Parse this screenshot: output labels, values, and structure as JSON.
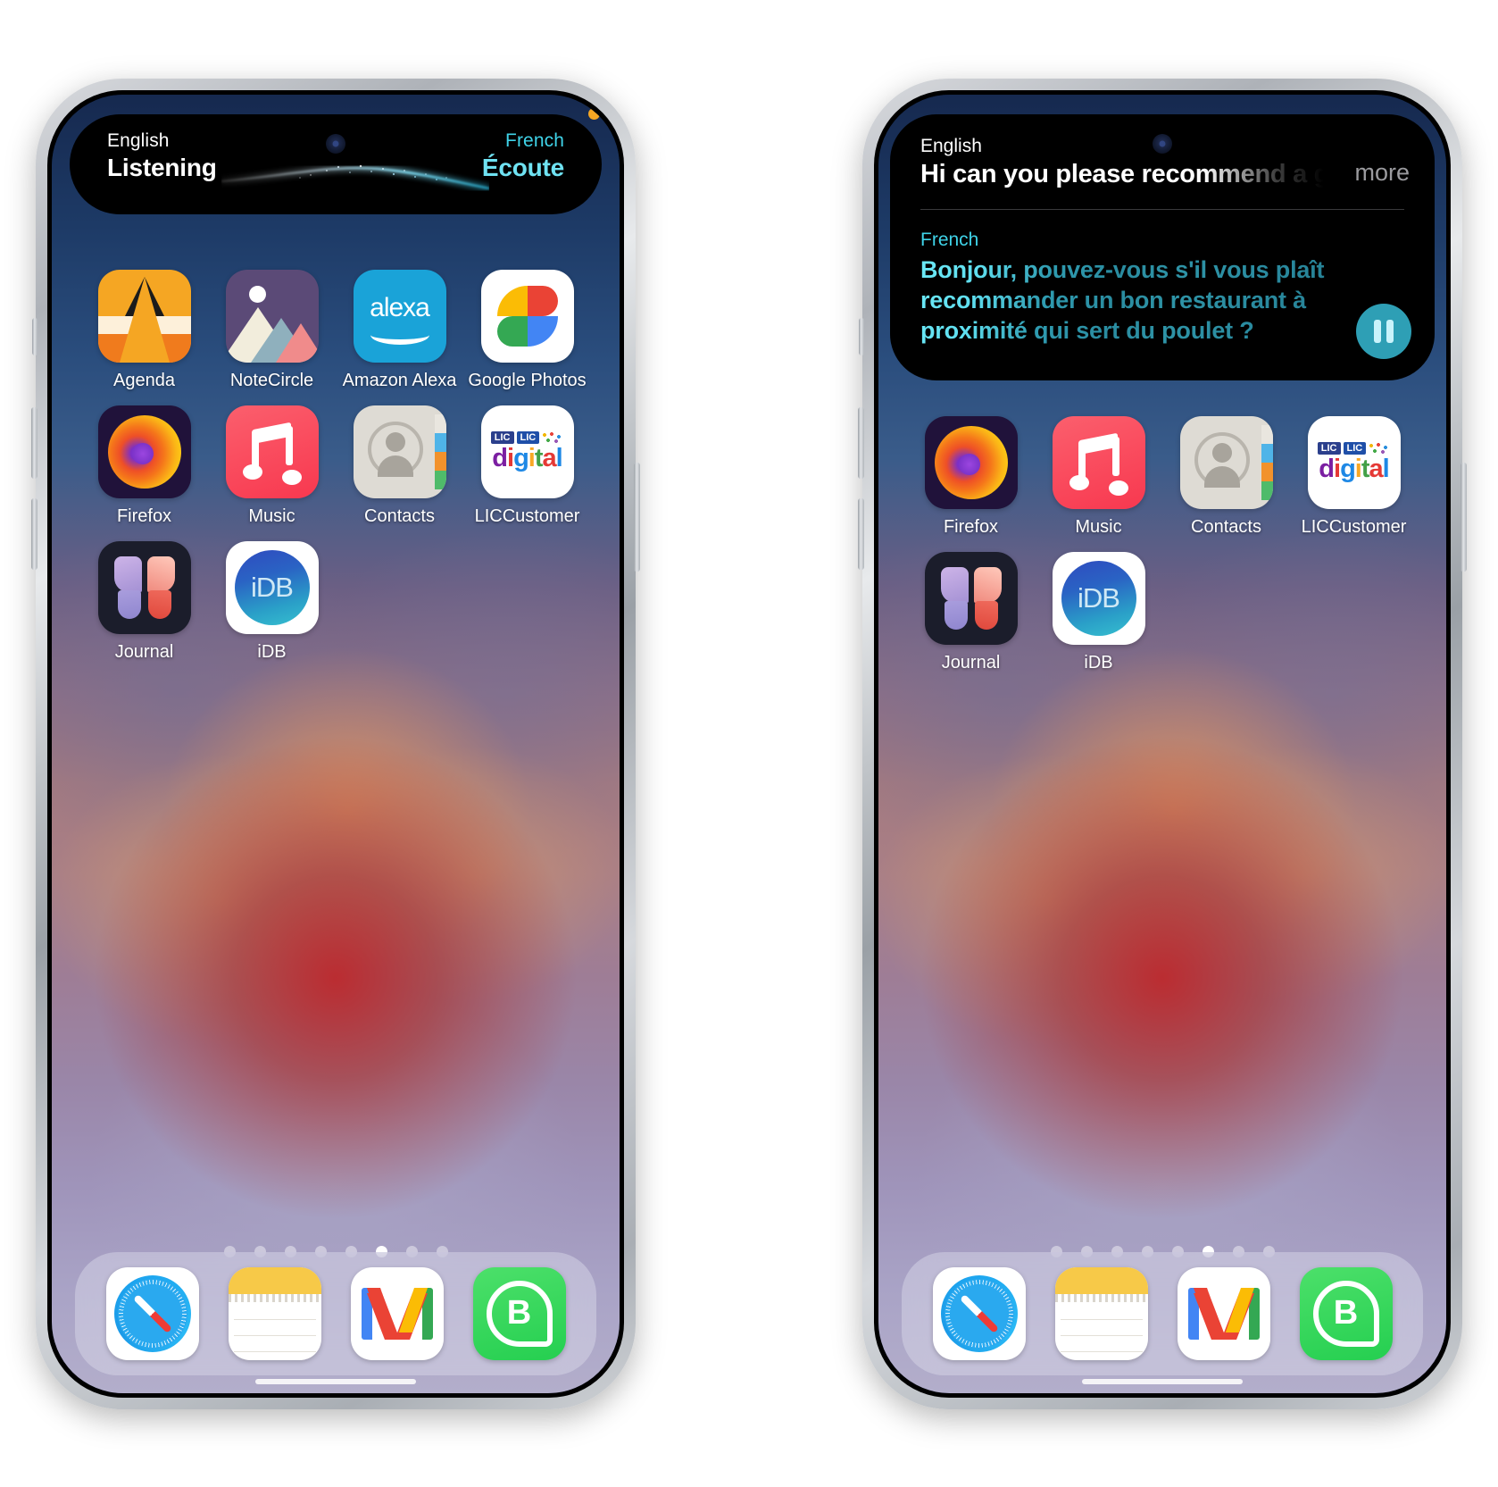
{
  "phones": [
    {
      "id": "phone-left",
      "island": {
        "state": "listening",
        "source_language": "English",
        "source_status": "Listening",
        "target_language": "French",
        "target_status": "Écoute",
        "mic_indicator_color": "#f5a623"
      },
      "apps": [
        [
          {
            "label": "Agenda",
            "icon": "agenda-icon"
          },
          {
            "label": "NoteCircle",
            "icon": "notecircle-icon"
          },
          {
            "label": "Amazon Alexa",
            "icon": "amazon-alexa-icon",
            "wordmark": "alexa"
          },
          {
            "label": "Google Photos",
            "icon": "google-photos-icon"
          }
        ],
        [
          {
            "label": "Firefox",
            "icon": "firefox-icon"
          },
          {
            "label": "Music",
            "icon": "music-icon"
          },
          {
            "label": "Contacts",
            "icon": "contacts-icon"
          },
          {
            "label": "LICCustomer",
            "icon": "liccustomer-icon",
            "badge1": "LIC",
            "badge2": "LIC",
            "wordmark": [
              "d",
              "i",
              "g",
              "i",
              "t",
              "a",
              "l"
            ]
          }
        ],
        [
          {
            "label": "Journal",
            "icon": "journal-icon"
          },
          {
            "label": "iDB",
            "icon": "idb-icon",
            "wordmark": "iDB"
          }
        ]
      ],
      "page_dots": {
        "count": 8,
        "active_index": 5
      },
      "dock": [
        {
          "label": "Safari",
          "icon": "safari-icon"
        },
        {
          "label": "Notes",
          "icon": "notes-icon"
        },
        {
          "label": "Gmail",
          "icon": "gmail-icon"
        },
        {
          "label": "WhatsApp Business",
          "icon": "whatsapp-business-icon",
          "wordmark": "B"
        }
      ]
    },
    {
      "id": "phone-right",
      "island": {
        "state": "expanded",
        "source_language": "English",
        "source_text": "Hi can you please recommend a good",
        "more_label": "more",
        "target_language": "French",
        "target_text": "Bonjour, pouvez-vous s'il vous plaît recommander un bon restaurant à proximité qui sert du poulet ?",
        "pause_button": "pause",
        "accent_color": "#2e9fb5",
        "target_text_color": "#3fd3e8"
      },
      "apps": [
        [
          {
            "label": "Firefox",
            "icon": "firefox-icon"
          },
          {
            "label": "Music",
            "icon": "music-icon"
          },
          {
            "label": "Contacts",
            "icon": "contacts-icon"
          },
          {
            "label": "LICCustomer",
            "icon": "liccustomer-icon",
            "badge1": "LIC",
            "badge2": "LIC",
            "wordmark": [
              "d",
              "i",
              "g",
              "i",
              "t",
              "a",
              "l"
            ]
          }
        ],
        [
          {
            "label": "Journal",
            "icon": "journal-icon"
          },
          {
            "label": "iDB",
            "icon": "idb-icon",
            "wordmark": "iDB"
          }
        ]
      ],
      "page_dots": {
        "count": 8,
        "active_index": 5
      },
      "dock": [
        {
          "label": "Safari",
          "icon": "safari-icon"
        },
        {
          "label": "Notes",
          "icon": "notes-icon"
        },
        {
          "label": "Gmail",
          "icon": "gmail-icon"
        },
        {
          "label": "WhatsApp Business",
          "icon": "whatsapp-business-icon",
          "wordmark": "B"
        }
      ]
    }
  ]
}
